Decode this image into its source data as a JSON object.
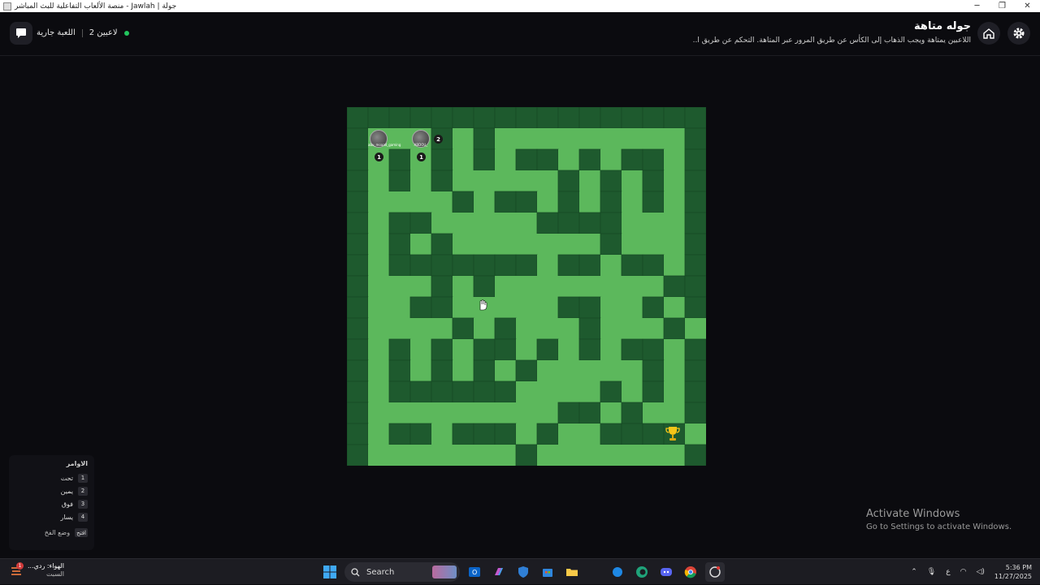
{
  "window": {
    "title": "منصة الألعاب التفاعلية للبث المباشر - Jawlah | جولة",
    "minimize": "─",
    "maximize": "❐",
    "close": "✕"
  },
  "header": {
    "title": "جوله متاهة",
    "subtitle": "اللاعبين يمتاهة ويجب الذهاب إلى الكأس عن طريق المرور عبر المتاهة. التحكم عن طريق ا..",
    "game_status": "اللعبة جارية",
    "players_count": "2 لاعبين",
    "icons": {
      "logo": "chat-logo-icon",
      "home": "home-icon",
      "settings": "gear-icon"
    }
  },
  "maze": {
    "rows": [
      "#################",
      "#...#.#.........#",
      "#.#.#.#.##.#.##.#",
      "#.#.#.....#.#.#.#",
      "#....#.##.#.#.#.#",
      "#.##.....####...#",
      "#.#.#.......#...#",
      "#.#######.##.##.#",
      "#...#.#........##",
      "#..##.....##..#.#",
      "#....#.#...#...#.#",
      "#.#.#.##.#.#.##.#",
      "#.#.#.#.#.....#.#",
      "#.######....#.#.#",
      "#.........##.#..#",
      "#.##.###.#..####.#",
      "#.......#.......#",
      "#################"
    ],
    "colors": {
      "wall": "#1e5a2e",
      "path": "#5cb85c",
      "grid": "#174a25"
    },
    "players": [
      {
        "name": "abu_moaad_gaming",
        "steps": "1"
      },
      {
        "name": "ABDOU_",
        "steps": "1",
        "number": "2"
      }
    ],
    "goal_icon": "trophy-icon"
  },
  "commands": {
    "title": "الاوامر",
    "items": [
      {
        "key": "1",
        "label": "تحت"
      },
      {
        "key": "2",
        "label": "يمين"
      },
      {
        "key": "3",
        "label": "فوق"
      },
      {
        "key": "4",
        "label": "يسار"
      }
    ],
    "footer_key": "افتح",
    "footer_label": "وضع الفخ"
  },
  "activation": {
    "title": "Activate Windows",
    "subtitle": "Go to Settings to activate Windows."
  },
  "taskbar": {
    "weather_title": "الهواء: ردي...",
    "weather_sub": "السبت",
    "weather_badge": "1",
    "search_label": "Search",
    "language": "ع",
    "time": "5:36 PM",
    "date": "11/27/2025"
  }
}
